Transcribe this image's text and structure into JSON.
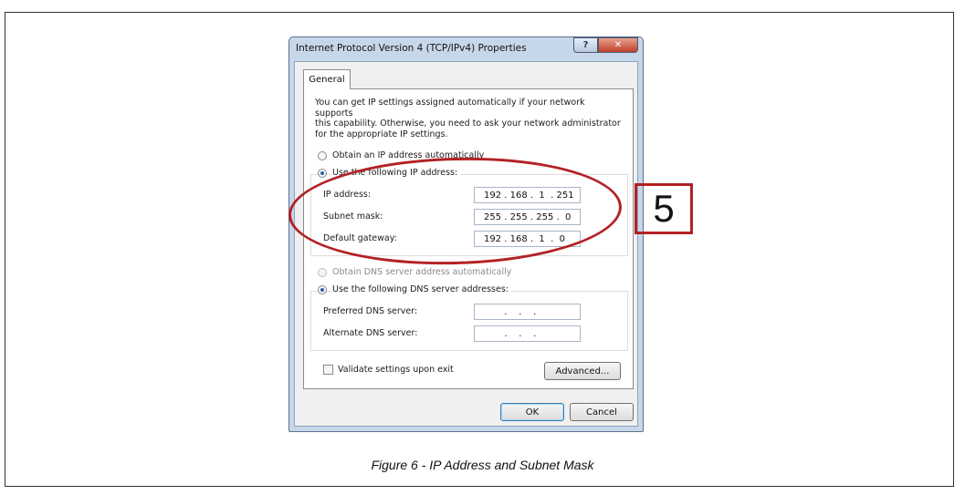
{
  "dialog": {
    "title": "Internet Protocol Version 4 (TCP/IPv4) Properties",
    "help_label": "?",
    "close_label": "✕",
    "tab_general": "General",
    "description": [
      "You can get IP settings assigned automatically if your network supports",
      "this capability. Otherwise, you need to ask your network administrator",
      "for the appropriate IP settings."
    ],
    "ip_section": {
      "auto_label": "Obtain an IP address automatically",
      "manual_label": "Use the following IP address:",
      "selected": "manual",
      "ip_address_label": "IP address:",
      "ip_address_value": "192 . 168 .  1  . 251",
      "subnet_mask_label": "Subnet mask:",
      "subnet_mask_value": "255 . 255 . 255 .  0",
      "gateway_label": "Default gateway:",
      "gateway_value": "192 . 168 .  1  .  0"
    },
    "dns_section": {
      "auto_label": "Obtain DNS server address automatically",
      "manual_label": "Use the following DNS server addresses:",
      "selected": "manual",
      "preferred_label": "Preferred DNS server:",
      "preferred_value": "  .    .    .  ",
      "alternate_label": "Alternate DNS server:",
      "alternate_value": "  .    .    .  "
    },
    "validate_label": "Validate settings upon exit",
    "validate_checked": false,
    "advanced_label": "Advanced...",
    "ok_label": "OK",
    "cancel_label": "Cancel"
  },
  "callout_number": "5",
  "caption": "Figure 6 - IP Address and Subnet Mask",
  "colors": {
    "annotation": "#b32124",
    "window_frame": "#c7d7ea"
  }
}
